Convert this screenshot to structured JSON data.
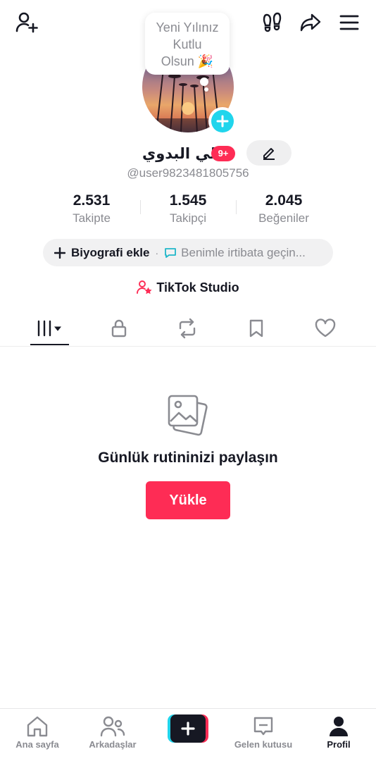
{
  "story_bubble": {
    "line1": "Yeni Yılınız",
    "line2": "Kutlu",
    "line3": "Olsun 🎉"
  },
  "profile": {
    "display_name": "علي البدوي",
    "notification_badge": "9+",
    "username": "@user9823481805756"
  },
  "stats": [
    {
      "value": "2.531",
      "label": "Takipte"
    },
    {
      "value": "1.545",
      "label": "Takipçi"
    },
    {
      "value": "2.045",
      "label": "Beğeniler"
    }
  ],
  "bio": {
    "add_label": "Biyografi ekle",
    "contact_label": "Benimle irtibata geçin..."
  },
  "studio": {
    "label": "TikTok Studio"
  },
  "tabs": [
    "videos-grid",
    "private",
    "reposts",
    "favorites",
    "liked"
  ],
  "empty_state": {
    "title": "Günlük rutininizi paylaşın",
    "button_label": "Yükle"
  },
  "bottom_nav": [
    {
      "label": "Ana sayfa",
      "icon": "home-icon"
    },
    {
      "label": "Arkadaşlar",
      "icon": "friends-icon"
    },
    {
      "label": "",
      "icon": "create-plus-icon"
    },
    {
      "label": "Gelen kutusu",
      "icon": "inbox-icon"
    },
    {
      "label": "Profil",
      "icon": "profile-icon"
    }
  ],
  "colors": {
    "accent_red": "#fe2c55",
    "accent_cyan": "#20d5ec",
    "text_primary": "#161823",
    "text_secondary": "#8a8b91"
  }
}
